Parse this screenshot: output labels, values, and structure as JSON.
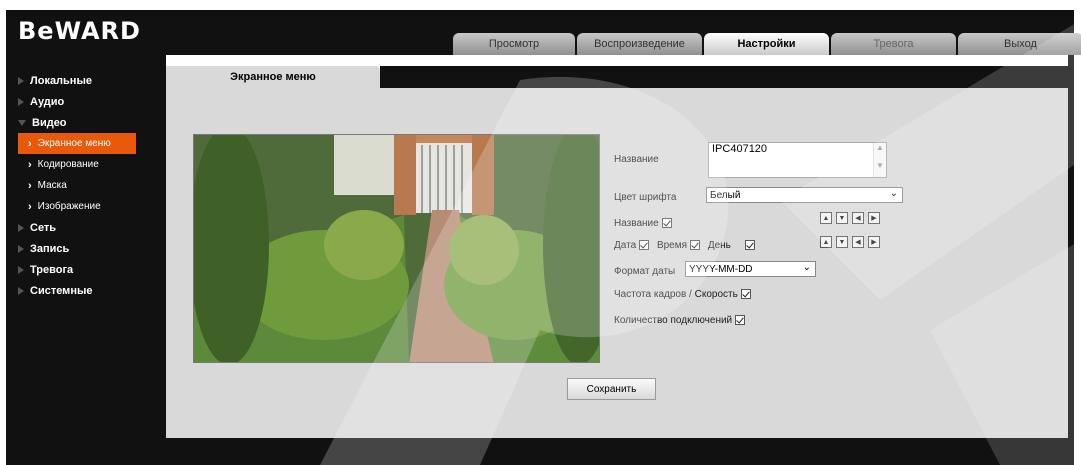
{
  "header": {
    "logo": "BeWARD",
    "tabs": [
      {
        "label": "Просмотр"
      },
      {
        "label": "Воспроизведение"
      },
      {
        "label": "Настройки",
        "active": true
      },
      {
        "label": "Тревога"
      },
      {
        "label": "Выход"
      }
    ]
  },
  "sidebar": {
    "items": [
      {
        "label": "Локальные"
      },
      {
        "label": "Аудио"
      },
      {
        "label": "Видео",
        "expanded": true
      },
      {
        "label": "Сеть"
      },
      {
        "label": "Запись"
      },
      {
        "label": "Тревога"
      },
      {
        "label": "Системные"
      }
    ],
    "video_sub": [
      {
        "label": "Экранное меню",
        "selected": true
      },
      {
        "label": "Кодирование"
      },
      {
        "label": "Маска"
      },
      {
        "label": "Изображение"
      }
    ]
  },
  "panel": {
    "tab_label": "Экранное меню"
  },
  "form": {
    "name_label": "Название",
    "name_value": "IPC407120",
    "font_color_label": "Цвет шрифта",
    "font_color_value": "Белый",
    "show_name_label": "Название",
    "date_label": "Дата",
    "time_label": "Время",
    "day_label": "День",
    "date_format_label": "Формат даты",
    "date_format_value": "YYYY-MM-DD",
    "fps_label": "Частота кадров / Скорость",
    "connections_label": "Количество подключений",
    "save_label": "Сохранить"
  },
  "colors": {
    "accent": "#e8590c",
    "frame": "#111111",
    "panel": "#d9d9d9"
  }
}
